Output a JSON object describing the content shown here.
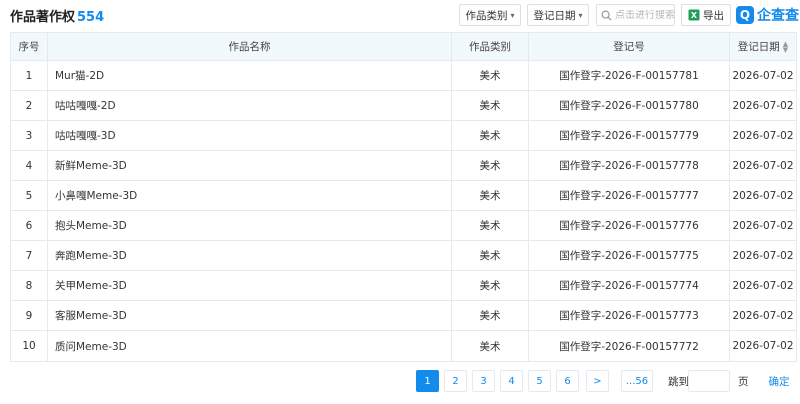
{
  "header": {
    "title": "作品著作权",
    "count": "554",
    "category_filter": "作品类别",
    "date_filter": "登记日期",
    "search_placeholder": "点击进行搜索",
    "export_label": "导出",
    "logo_mark": "Q",
    "logo_text": "企查查"
  },
  "table": {
    "columns": {
      "index": "序号",
      "name": "作品名称",
      "category": "作品类别",
      "reg_no": "登记号",
      "reg_date": "登记日期"
    },
    "rows": [
      {
        "index": "1",
        "name": "Mur猫-2D",
        "category": "美术",
        "reg_no": "国作登字-2026-F-00157781",
        "reg_date": "2026-07-02"
      },
      {
        "index": "2",
        "name": "咕咕嘎嘎-2D",
        "category": "美术",
        "reg_no": "国作登字-2026-F-00157780",
        "reg_date": "2026-07-02"
      },
      {
        "index": "3",
        "name": "咕咕嘎嘎-3D",
        "category": "美术",
        "reg_no": "国作登字-2026-F-00157779",
        "reg_date": "2026-07-02"
      },
      {
        "index": "4",
        "name": "新鲜Meme-3D",
        "category": "美术",
        "reg_no": "国作登字-2026-F-00157778",
        "reg_date": "2026-07-02"
      },
      {
        "index": "5",
        "name": "小鼻嘎Meme-3D",
        "category": "美术",
        "reg_no": "国作登字-2026-F-00157777",
        "reg_date": "2026-07-02"
      },
      {
        "index": "6",
        "name": "抱头Meme-3D",
        "category": "美术",
        "reg_no": "国作登字-2026-F-00157776",
        "reg_date": "2026-07-02"
      },
      {
        "index": "7",
        "name": "奔跑Meme-3D",
        "category": "美术",
        "reg_no": "国作登字-2026-F-00157775",
        "reg_date": "2026-07-02"
      },
      {
        "index": "8",
        "name": "关甲Meme-3D",
        "category": "美术",
        "reg_no": "国作登字-2026-F-00157774",
        "reg_date": "2026-07-02"
      },
      {
        "index": "9",
        "name": "客服Meme-3D",
        "category": "美术",
        "reg_no": "国作登字-2026-F-00157773",
        "reg_date": "2026-07-02"
      },
      {
        "index": "10",
        "name": "质问Meme-3D",
        "category": "美术",
        "reg_no": "国作登字-2026-F-00157772",
        "reg_date": "2026-07-02"
      }
    ]
  },
  "pagination": {
    "pages": [
      "1",
      "2",
      "3",
      "4",
      "5",
      "6"
    ],
    "current": "1",
    "next": ">",
    "last": "...56",
    "jump_label": "跳到",
    "jump_value": "",
    "page_unit": "页",
    "confirm": "确定"
  },
  "colors": {
    "accent": "#128bed",
    "header_bg": "#f2f9fc",
    "border": "#e4eaf2"
  }
}
